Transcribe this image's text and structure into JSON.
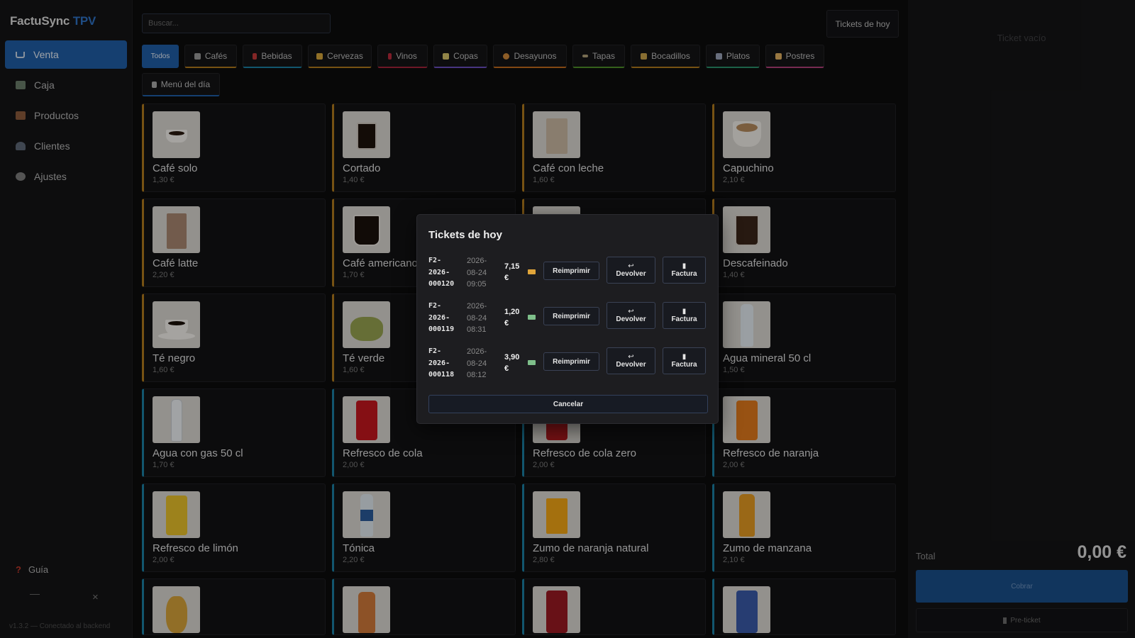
{
  "brand": {
    "name": "FactuSync",
    "accent": "TPV"
  },
  "sidebar": {
    "items": [
      {
        "label": "Venta",
        "icon": "cart-icon",
        "active": true
      },
      {
        "label": "Caja",
        "icon": "cash-register-icon"
      },
      {
        "label": "Productos",
        "icon": "box-icon"
      },
      {
        "label": "Clientes",
        "icon": "users-icon"
      },
      {
        "label": "Ajustes",
        "icon": "gear-icon"
      }
    ],
    "guide": "Guía",
    "version": "v1.3.2 — Conectado al backend"
  },
  "search": {
    "placeholder": "Buscar..."
  },
  "header": {
    "tickets_button": "Tickets de hoy"
  },
  "categories": [
    {
      "label": "Todos",
      "active": true
    },
    {
      "label": "Cafés",
      "color": "#b07a1c"
    },
    {
      "label": "Bebidas",
      "color": "#1b7fa3"
    },
    {
      "label": "Cervezas",
      "color": "#b07a1c"
    },
    {
      "label": "Vinos",
      "color": "#a3243a"
    },
    {
      "label": "Copas",
      "color": "#6a4fbf"
    },
    {
      "label": "Desayunos",
      "color": "#c26b1c"
    },
    {
      "label": "Tapas",
      "color": "#4e8f2a"
    },
    {
      "label": "Bocadillos",
      "color": "#b07a1c"
    },
    {
      "label": "Platos",
      "color": "#2a8f6a"
    },
    {
      "label": "Postres",
      "color": "#b0407a"
    },
    {
      "label": "Menú del día",
      "color": "#1f5ea6"
    }
  ],
  "products": [
    {
      "name": "Café solo",
      "price": "1,30 €"
    },
    {
      "name": "Cortado",
      "price": "1,40 €"
    },
    {
      "name": "Café con leche",
      "price": "1,60 €"
    },
    {
      "name": "Capuchino",
      "price": "2,10 €"
    },
    {
      "name": "Café latte",
      "price": "2,20 €"
    },
    {
      "name": "Café americano",
      "price": "1,70 €"
    },
    {
      "name": "",
      "price": ""
    },
    {
      "name": "Descafeinado",
      "price": "1,40 €"
    },
    {
      "name": "Té negro",
      "price": "1,60 €"
    },
    {
      "name": "Té verde",
      "price": "1,60 €"
    },
    {
      "name": "",
      "price": ""
    },
    {
      "name": "Agua mineral 50 cl",
      "price": "1,50 €"
    },
    {
      "name": "Agua con gas 50 cl",
      "price": "1,70 €"
    },
    {
      "name": "Refresco de cola",
      "price": "2,00 €"
    },
    {
      "name": "Refresco de cola zero",
      "price": "2,00 €"
    },
    {
      "name": "Refresco de naranja",
      "price": "2,00 €"
    },
    {
      "name": "Refresco de limón",
      "price": "2,00 €"
    },
    {
      "name": "Tónica",
      "price": "2,20 €"
    },
    {
      "name": "Zumo de naranja natural",
      "price": "2,80 €"
    },
    {
      "name": "Zumo de manzana",
      "price": "2,10 €"
    },
    {
      "name": "",
      "price": ""
    },
    {
      "name": "",
      "price": ""
    },
    {
      "name": "",
      "price": ""
    },
    {
      "name": "",
      "price": ""
    }
  ],
  "ticket": {
    "empty": "Ticket vacío",
    "total_label": "Total",
    "total_value": "0,00 €",
    "pay_button": "Cobrar",
    "preticket_button": "Pre-ticket"
  },
  "modal": {
    "title": "Tickets de hoy",
    "rows": [
      {
        "num1": "F2-",
        "num2": "2026-",
        "num3": "000120",
        "date1": "2026-",
        "date2": "08-24",
        "date3": "09:05",
        "amt1": "7,15",
        "amt2": "€",
        "method": "card"
      },
      {
        "num1": "F2-",
        "num2": "2026-",
        "num3": "000119",
        "date1": "2026-",
        "date2": "08-24",
        "date3": "08:31",
        "amt1": "1,20",
        "amt2": "€",
        "method": "cash"
      },
      {
        "num1": "F2-",
        "num2": "2026-",
        "num3": "000118",
        "date1": "2026-",
        "date2": "08-24",
        "date3": "08:12",
        "amt1": "3,90",
        "amt2": "€",
        "method": "cash"
      }
    ],
    "reprint": "Reimprimir",
    "refund": "Devolver",
    "invoice": "Factura",
    "cancel": "Cancelar"
  },
  "colors": {
    "accent": "#1f5ea6",
    "coffee": "#b07a1c",
    "drinks": "#1b7fa3"
  }
}
